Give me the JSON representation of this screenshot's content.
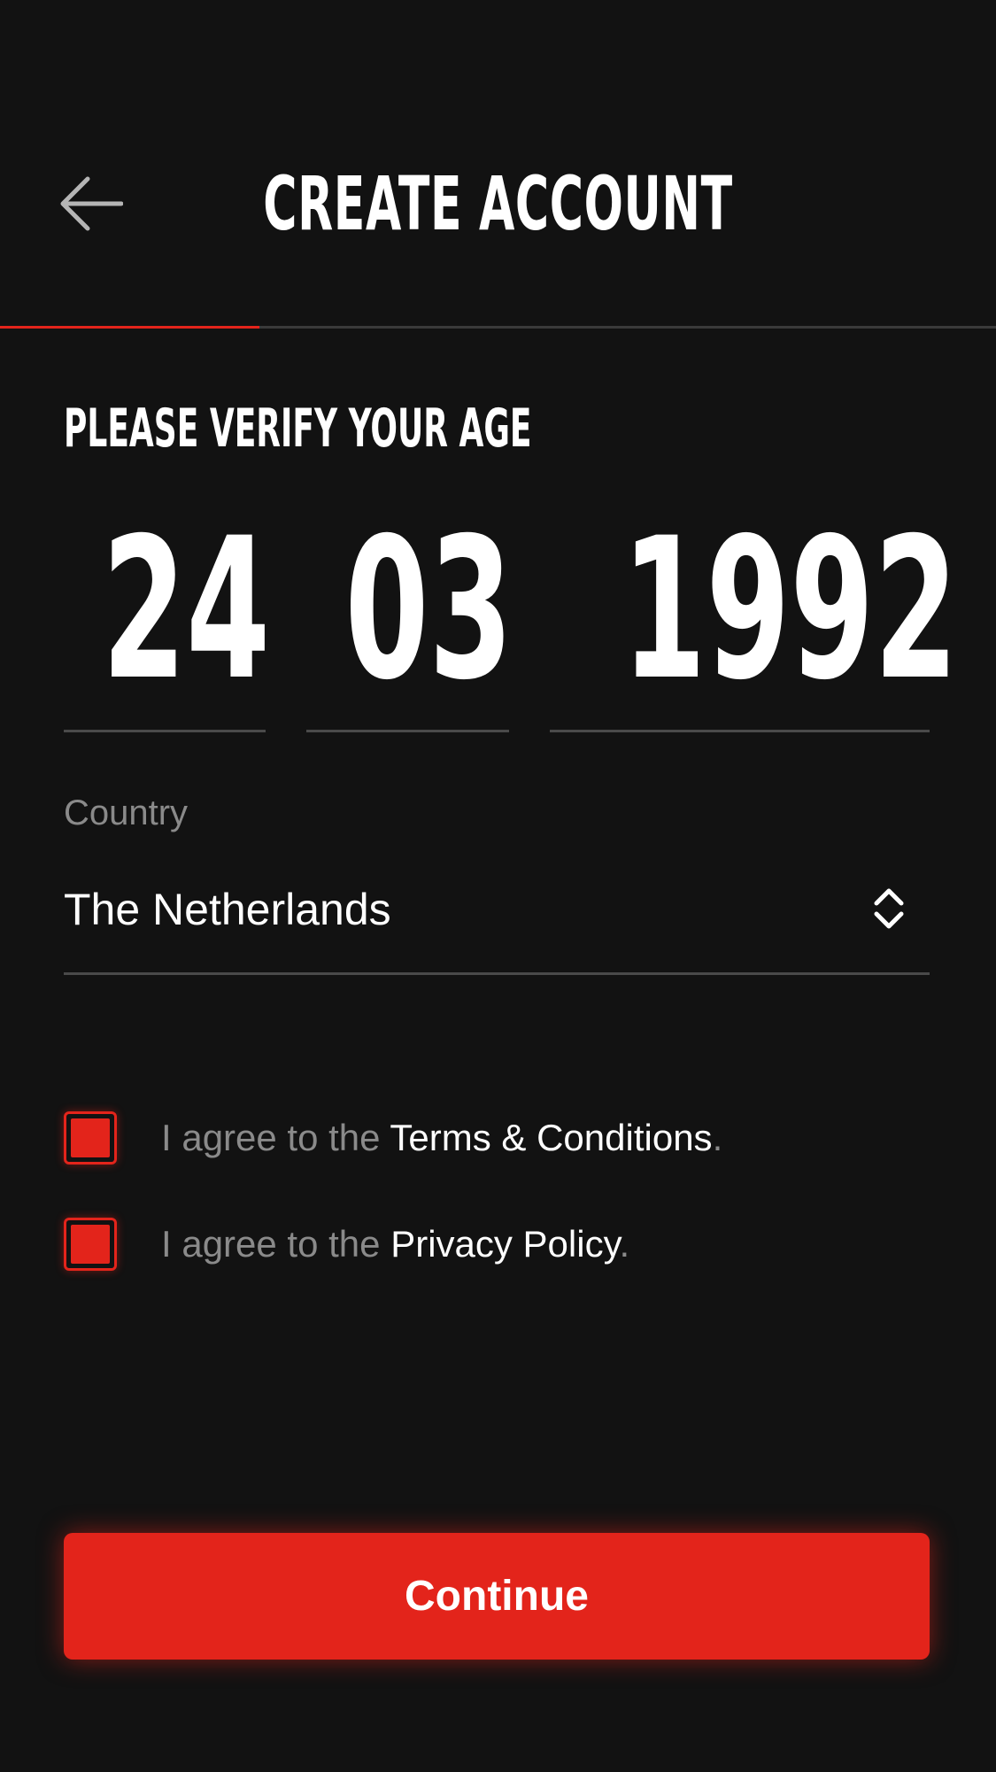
{
  "header": {
    "title": "CREATE ACCOUNT",
    "back_icon": "arrow-left-icon",
    "progress_fraction": 0.26,
    "progress_color": "#e3241b"
  },
  "age": {
    "heading": "PLEASE VERIFY YOUR AGE",
    "day": "24",
    "month": "03",
    "year": "1992"
  },
  "country": {
    "label": "Country",
    "value": "The Netherlands",
    "icon": "chevron-updown-icon"
  },
  "agreements": [
    {
      "prefix": "I agree to the ",
      "link": "Terms & Conditions",
      "suffix": ".",
      "checked": true
    },
    {
      "prefix": "I agree to the ",
      "link": "Privacy Policy",
      "suffix": ".",
      "checked": true
    }
  ],
  "continue_label": "Continue",
  "colors": {
    "background": "#121212",
    "accent": "#e3241b",
    "muted_text": "#8a8a8a"
  }
}
